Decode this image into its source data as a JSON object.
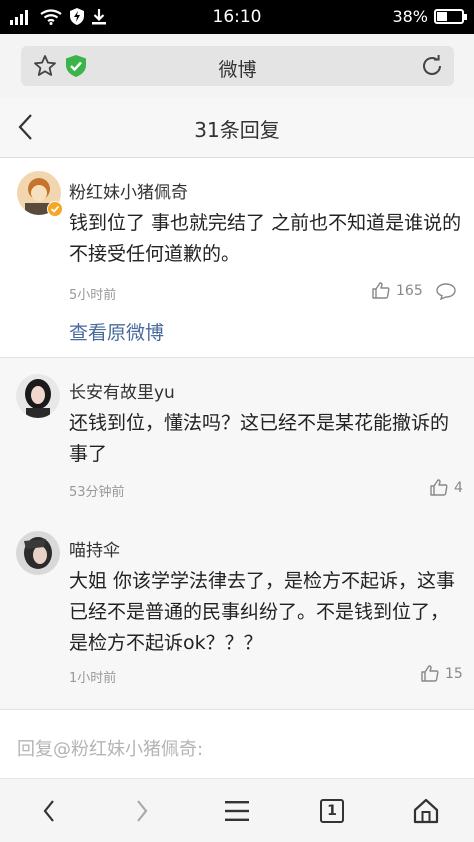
{
  "status_bar": {
    "time": "16:10",
    "battery": "38%",
    "battery_level": 0.38
  },
  "browser": {
    "title": "微博"
  },
  "header": {
    "title": "31条回复"
  },
  "main_comment": {
    "username": "粉红妹小猪佩奇",
    "text": "钱到位了 事也就完结了 之前也不知道是谁说的不接受任何道歉的。",
    "time": "5小时前",
    "likes": "165",
    "view_original": "查看原微博"
  },
  "replies": [
    {
      "username": "长安有故里yu",
      "text": "还钱到位，懂法吗？这已经不是某花能撤诉的事了",
      "time": "53分钟前",
      "likes": "4"
    },
    {
      "username": "喵持伞",
      "text": "大姐 你该学学法律去了，是检方不起诉，这事已经不是普通的民事纠纷了。不是钱到位了，是检方不起诉ok？？？",
      "time": "1小时前",
      "likes": "15"
    }
  ],
  "reply_input": {
    "placeholder": "回复@粉红妹小猪佩奇:"
  },
  "bottom_nav": {
    "tab_count": "1"
  },
  "colors": {
    "link": "#4a6a9c",
    "verified_badge": "#f5a623",
    "shield": "#3bb54a"
  }
}
